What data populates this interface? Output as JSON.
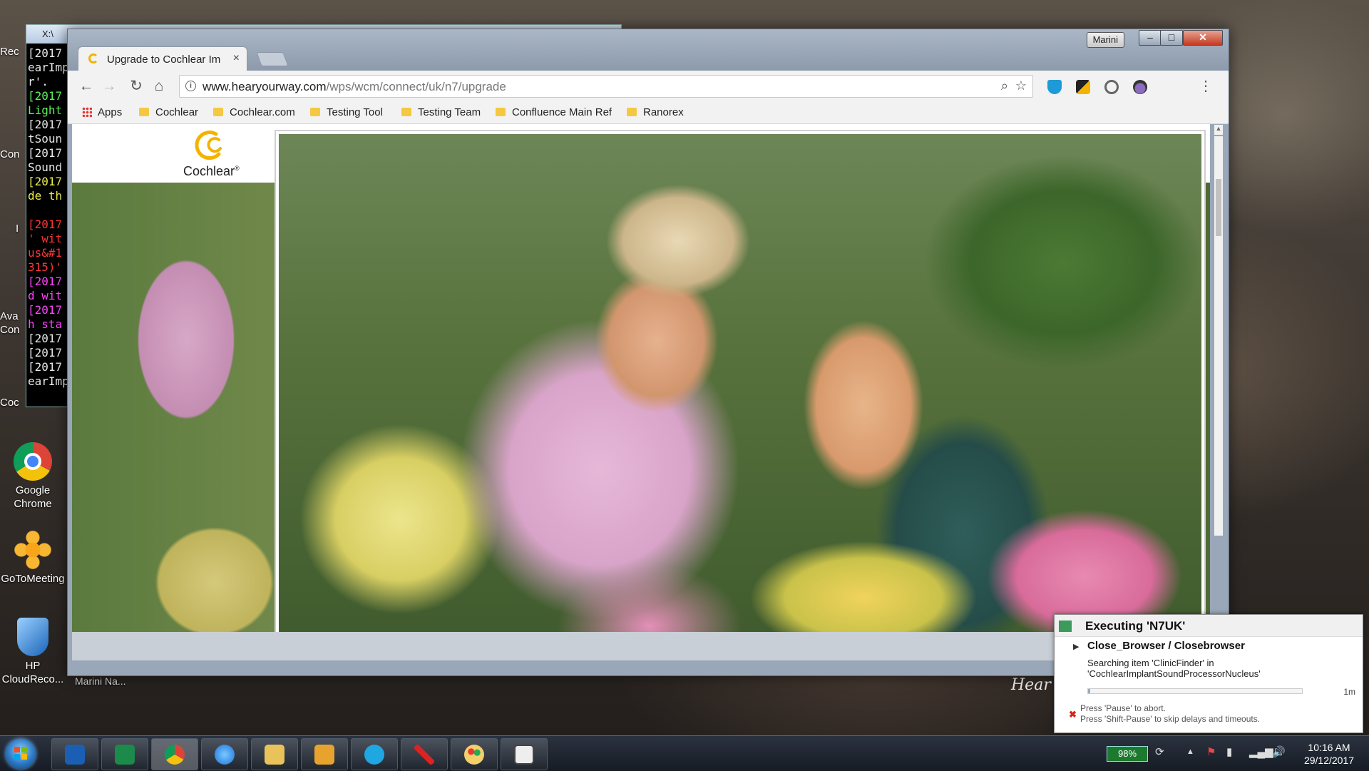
{
  "desktop": {
    "icons": [
      {
        "label": "Google Chrome"
      },
      {
        "label": "GoToMeeting"
      },
      {
        "label": "HP CloudReco..."
      }
    ],
    "partial_labels": [
      "Rec",
      "Con",
      "I",
      "Ava Con",
      "Coc"
    ]
  },
  "console": {
    "title": "X:\\",
    "lines": [
      {
        "text": "[2017",
        "color": "white"
      },
      {
        "text": "earImp",
        "color": "white"
      },
      {
        "text": "r'.",
        "color": "white"
      },
      {
        "text": "[2017",
        "color": "green"
      },
      {
        "text": "Light",
        "color": "green"
      },
      {
        "text": "[2017",
        "color": "white"
      },
      {
        "text": "tSoun",
        "color": "white"
      },
      {
        "text": "[2017",
        "color": "white"
      },
      {
        "text": "Sound",
        "color": "white"
      },
      {
        "text": "[2017",
        "color": "yellow"
      },
      {
        "text": "de th",
        "color": "yellow"
      },
      {
        "text": "",
        "color": "white"
      },
      {
        "text": "[2017",
        "color": "red"
      },
      {
        "text": "' wit",
        "color": "red"
      },
      {
        "text": "us&#1",
        "color": "red"
      },
      {
        "text": "315)'",
        "color": "red"
      },
      {
        "text": "[2017",
        "color": "magenta"
      },
      {
        "text": "d wit",
        "color": "magenta"
      },
      {
        "text": "[2017",
        "color": "magenta"
      },
      {
        "text": "h sta",
        "color": "magenta"
      },
      {
        "text": "[2017",
        "color": "white"
      },
      {
        "text": "[2017",
        "color": "white"
      },
      {
        "text": "[2017",
        "color": "white"
      },
      {
        "text": "earImp",
        "color": "white"
      }
    ]
  },
  "browser": {
    "profile": "Marini",
    "window_controls": {
      "minimize": "–",
      "maximize": "□",
      "close": "✕"
    },
    "tab": {
      "title": "Upgrade to Cochlear Imp",
      "close": "×"
    },
    "url_domain": "www.hearyourway.com",
    "url_path": "/wps/wcm/connect/uk/n7/upgrade",
    "bookmarks": [
      "Apps",
      "Cochlear",
      "Cochlear.com",
      "Testing Tool",
      "Testing Team",
      "Confluence Main Ref",
      "Ranorex"
    ],
    "page": {
      "logo_text": "Cochlear",
      "logo_reg": "®",
      "hero_caption": "Hear"
    }
  },
  "footer_name": "Marini Na...",
  "ranorex": {
    "title": "Executing 'N7UK'",
    "item": "Close_Browser / Closebrowser",
    "desc_line1": "Searching item 'ClinicFinder' in",
    "desc_line2": "'CochlearImplantSoundProcessorNucleus'",
    "progress": 0.01,
    "time": "1m",
    "hint1": "Press 'Pause' to abort.",
    "hint2": "Press 'Shift-Pause' to skip delays and timeouts."
  },
  "taskbar": {
    "apps": [
      "outlook",
      "sharepoint",
      "chrome",
      "internet-explorer",
      "file-explorer",
      "media-player",
      "skype",
      "snipping-tool",
      "paint",
      "console"
    ],
    "battery": "98%",
    "time": "10:16 AM",
    "date": "29/12/2017"
  },
  "colors": {
    "cochlear_yellow": "#f3b300",
    "ranorex_green": "#3c9a5c",
    "close_red": "#c43a22"
  }
}
